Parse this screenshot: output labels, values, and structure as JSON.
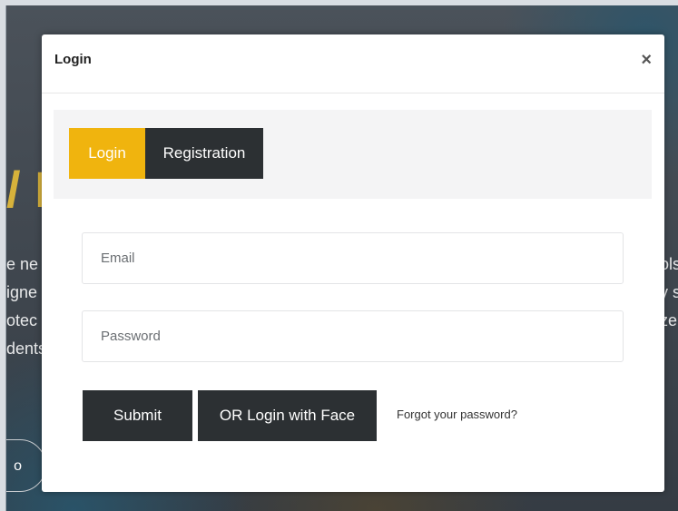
{
  "modal": {
    "title": "Login",
    "close_label": "×",
    "tabs": [
      {
        "label": "Login",
        "active": true
      },
      {
        "label": "Registration",
        "active": false
      }
    ],
    "email": {
      "placeholder": "Email"
    },
    "password": {
      "placeholder": "Password"
    },
    "submit_label": "Submit",
    "face_login_label": "OR Login with Face",
    "forgot_label": "Forgot your password?"
  },
  "background": {
    "accent_fragment": "/ L",
    "left_lines": [
      "e ne",
      "igne",
      "otec",
      "dents"
    ],
    "right_lines": [
      "ols",
      "y s",
      "ze",
      ""
    ],
    "pill_fragment": "o"
  },
  "colors": {
    "accent": "#f0b40e",
    "dark_button": "#2c3033",
    "tab_panel_bg": "#f4f4f5"
  }
}
